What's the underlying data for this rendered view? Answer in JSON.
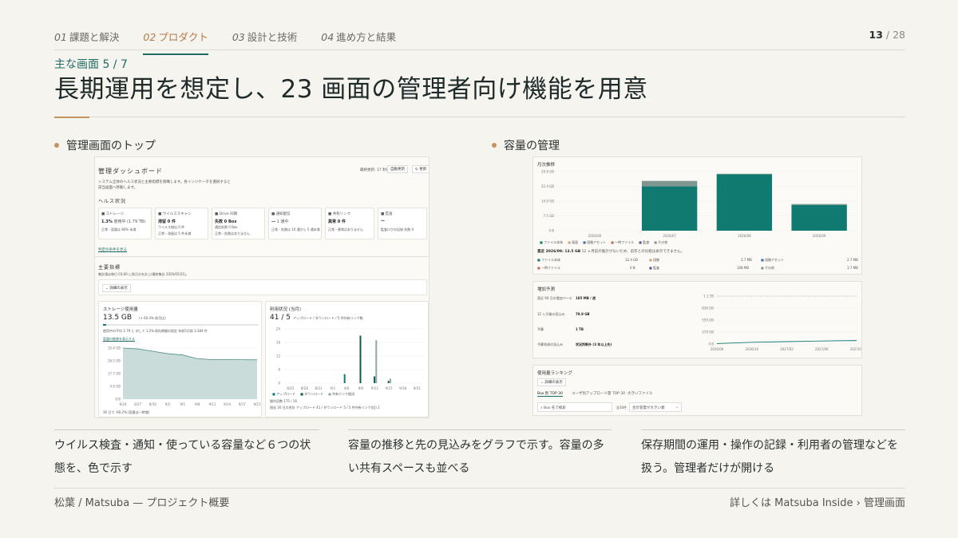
{
  "nav": {
    "tabs": [
      {
        "num": "01",
        "label": "課題と解決"
      },
      {
        "num": "02",
        "label": "プロダクト"
      },
      {
        "num": "03",
        "label": "設計と技術"
      },
      {
        "num": "04",
        "label": "進め方と結果"
      }
    ],
    "page_current": "13",
    "page_sep": " / ",
    "page_total": "28"
  },
  "kicker": "主な画面 5 / 7",
  "title": "長期運用を想定し、23 画面の管理者向け機能を用意",
  "sections": {
    "left": "管理画面のトップ",
    "right": "容量の管理"
  },
  "dashboard": {
    "title": "管理ダッシュボード",
    "updated": "最終更新: 17 秒前",
    "auto_refresh": "自動更新",
    "refresh": "更新",
    "desc1": "システム全体のヘルス状況と主要指標を俯瞰します。各インジケータを選択すると",
    "desc2": "該当画面へ移動します。",
    "health_heading": "ヘルス状況",
    "health": [
      {
        "name": "ストレージ",
        "value": "1.3%",
        "sub": "使用中 (1.79 TB)",
        "note": "正常・容量は 80% 未満"
      },
      {
        "name": "ウイルススキャン",
        "value": "滞留 0 件",
        "sub": "ウイルス検出 0 件",
        "note": "正常・滞留は 5 件未満"
      },
      {
        "name": "Drive 同期",
        "value": "失敗 0 Box",
        "sub": "通信失敗 0 Box",
        "note": "正常・失敗はありません"
      },
      {
        "name": "通知配信",
        "value": "—",
        "sub": "1 通中",
        "note": "正常・失敗は 10 通から 5 通未満"
      },
      {
        "name": "共有リンク",
        "value": "異常 0 件",
        "sub": "",
        "note": "正常・異常はありません"
      },
      {
        "name": "監査",
        "value": "—",
        "sub": "",
        "note": "監査ログの記録 失敗 0"
      }
    ],
    "health_link": "判定の条件を見る",
    "metrics_heading": "主要指標",
    "metrics_desc": "集計値は毎日 03:00 に前日分を計上(最終集計 2026/05/21)。",
    "filter_label": "詳細の表示",
    "storage": {
      "title": "ストレージ使用量",
      "value": "13.5 GB",
      "delta": "(+ 60.4% 前月比)",
      "line1": "使用中の平均 1.79 と 対して 1.2%",
      "line2": "保存期間の設定 年前5月前 3,384 件",
      "link": "容量の推移を表示する",
      "note": "30 日で -60.2% (容量は一時増)"
    },
    "activity": {
      "title": "利用状況 (当月)",
      "value": "41 / 5",
      "sub": "アップロード / ダウンロード / 5 件共有リンク数",
      "legend": [
        "アップロード",
        "ダウンロード",
        "共有リンク経由"
      ],
      "note1": "操作回数 175 / 16",
      "note2": "過去 30 日の合計 アップロード 41 / ダウンロード 5 / 5 件共有リンク(回) 2"
    }
  },
  "capacity": {
    "monthly_title": "月次推移",
    "monthly_legend": [
      "ファイル本体",
      "画面",
      "段階アセット",
      "一時ファイル",
      "監査",
      "その他"
    ],
    "monthly_summary": "直近 2026/09: 13.5 GB",
    "monthly_summary_note": "12 ヶ月前の集計がないため、前年との比較は表示できません。",
    "breakdown": [
      {
        "name": "ファイル本体",
        "value": "12.4 GB",
        "name2": "段階",
        "value2": "2.7 MB",
        "name3": "段階アセット",
        "value3": "2.7 MB"
      },
      {
        "name": "一時ファイル",
        "value": "0 B",
        "name2": "監査",
        "value2": "108 MB",
        "name3": "その他",
        "value3": "3.7 MB"
      }
    ],
    "forecast": {
      "title": "増加予測",
      "rows": [
        {
          "k": "直近 90 日の増加ペース",
          "v": "185 MB / 週"
        },
        {
          "k": "12 ヶ月後の見込み",
          "v": "79.9 GB"
        },
        {
          "k": "予算",
          "v": "1 TB"
        },
        {
          "k": "予算到達の見込み",
          "v": "状況判断外 (3 年以上先)"
        }
      ]
    },
    "ranking": {
      "title": "使用量ランキング",
      "filter": "詳細の表示",
      "tabs": [
        "Box 別 TOP 30",
        "ユーザ別アップロード量 TOP 30",
        "大きいファイル"
      ],
      "search": "Box 名で検索",
      "count_label": "全10件",
      "sort": "合計容量が大きい順"
    }
  },
  "chart_data": [
    {
      "type": "line",
      "title": "ストレージ使用量",
      "x": [
        "8/24",
        "8/27",
        "8/30",
        "9/2",
        "9/5",
        "9/8",
        "9/11",
        "9/14",
        "9/17",
        "9/21"
      ],
      "y_ticks": [
        "0 B",
        "4.6 GB",
        "17.7 GB",
        "26.5 GB",
        "35.4 GB"
      ],
      "series": [
        {
          "values": [
            35.4,
            34.8,
            33.2,
            31.5,
            30.6,
            28.0,
            27.4,
            27.4,
            27.3,
            27.2
          ]
        }
      ]
    },
    {
      "type": "bar",
      "title": "利用状況 (当月)",
      "x": [
        "8/25",
        "8/28",
        "8/31",
        "9/3",
        "9/6",
        "9/9",
        "9/12",
        "9/15",
        "9/18",
        "9/21"
      ],
      "ylim": [
        0,
        24
      ],
      "y_ticks": [
        "0",
        "6",
        "12",
        "18",
        "24"
      ],
      "series": [
        {
          "name": "アップロード",
          "values": [
            0,
            0,
            0,
            0,
            4,
            0,
            0,
            0,
            0,
            0
          ]
        },
        {
          "name": "ダウンロード",
          "values": [
            0,
            0,
            0,
            0,
            0,
            21,
            3,
            1,
            0,
            0
          ]
        },
        {
          "name": "共有リンク経由",
          "values": [
            0,
            0,
            0,
            0,
            0,
            0,
            19,
            2,
            0,
            0
          ]
        }
      ]
    },
    {
      "type": "bar",
      "title": "月次推移",
      "categories": [
        "2026/06",
        "2026/07",
        "2026/08",
        "2026/09"
      ],
      "ylim": [
        0,
        29.9
      ],
      "y_ticks": [
        "0 B",
        "7.5 GB",
        "14.9 GB",
        "22.4 GB",
        "29.9 GB"
      ],
      "series": [
        {
          "name": "ファイル本体",
          "values": [
            0,
            22.5,
            28.5,
            13.0
          ]
        },
        {
          "name": "その他",
          "values": [
            0,
            2.7,
            0.3,
            0.5
          ]
        }
      ]
    },
    {
      "type": "line",
      "title": "増加予測",
      "x": [
        "2026/06",
        "2026/10",
        "2027/02",
        "2027/06",
        "2027/09"
      ],
      "y_ticks": [
        "0 B",
        "279 GB",
        "559 GB",
        "838 GB",
        "1.1 TB"
      ],
      "series": [
        {
          "name": "予算",
          "values": [
            1100,
            1100,
            1100,
            1100,
            1100
          ]
        },
        {
          "name": "見込み",
          "values": [
            10,
            40,
            55,
            70,
            80
          ]
        }
      ]
    }
  ],
  "captions": [
    "ウイルス検査・通知・使っている容量など６つの状態を、色で示す",
    "容量の推移と先の見込みをグラフで示す。容量の多い共有スペースも並べる",
    "保存期間の運用・操作の記録・利用者の管理などを扱う。管理者だけが開ける"
  ],
  "footer": {
    "left": "松葉 / Matsuba — プロジェクト概要",
    "right": "詳しくは Matsuba Inside › 管理画面"
  },
  "colors": {
    "accent": "#c4935f",
    "teal": "#1f6b63",
    "chart_teal": "#117a70",
    "chart_gray": "#7f9590"
  }
}
